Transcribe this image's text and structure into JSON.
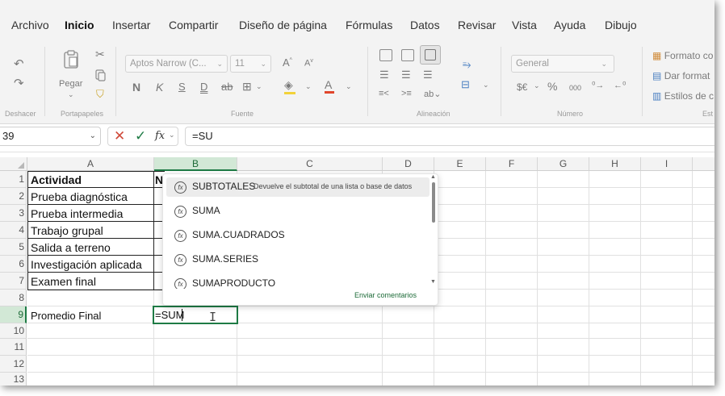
{
  "menu": [
    "Archivo",
    "Inicio",
    "Insertar",
    "Compartir",
    "Diseño de página",
    "Fórmulas",
    "Datos",
    "Revisar",
    "Vista",
    "Ayuda",
    "Dibujo"
  ],
  "ribbon": {
    "groups": {
      "undo": "Deshacer",
      "clipboard": "Portapapeles",
      "font": "Fuente",
      "alignment": "Alineación",
      "number": "Número",
      "styles": "Est"
    },
    "paste_label": "Pegar",
    "font_name": "Aptos Narrow (C...",
    "font_size": "11",
    "bold": "N",
    "italic": "K",
    "underline": "S",
    "double_underline": "D",
    "number_format": "General",
    "currency": "$€",
    "percent": "%",
    "thousands": "000",
    "style_items": [
      "Formato co",
      "Dar format",
      "Estilos de c"
    ]
  },
  "formula_bar": {
    "name_box": "39",
    "fx": "fx",
    "formula": "=SU"
  },
  "columns": [
    "A",
    "B",
    "C",
    "D",
    "E",
    "F",
    "G",
    "H",
    "I"
  ],
  "rows": [
    "1",
    "2",
    "3",
    "4",
    "5",
    "6",
    "7",
    "8",
    "9",
    "10",
    "11",
    "12",
    "13"
  ],
  "cells": {
    "a1": "Actividad",
    "b1": "N",
    "a2": "Prueba diagnóstica",
    "a3": "Prueba intermedia",
    "a4": "Trabajo grupal",
    "a5": "Salida a terreno",
    "a6": "Investigación aplicada",
    "a7": "Examen final",
    "a9": "Promedio Final",
    "b9": "=SUM"
  },
  "autocomplete": {
    "items": [
      {
        "name": "SUBTOTALES",
        "description": "Devuelve el subtotal de una lista o base de datos"
      },
      {
        "name": "SUMA",
        "description": ""
      },
      {
        "name": "SUMA.CUADRADOS",
        "description": ""
      },
      {
        "name": "SUMA.SERIES",
        "description": ""
      },
      {
        "name": "SUMAPRODUCTO",
        "description": ""
      }
    ],
    "feedback": "Enviar comentarios"
  },
  "colors": {
    "accent_green": "#1e7b45",
    "header_selected": "#d2e8d6"
  },
  "icons": [
    "undo-icon",
    "redo-icon",
    "cut-icon",
    "copy-icon",
    "format-painter-icon",
    "paste-icon",
    "borders-icon",
    "fill-color-icon",
    "font-color-icon",
    "cancel-icon",
    "enter-icon",
    "function-icon",
    "text-cursor-icon"
  ]
}
